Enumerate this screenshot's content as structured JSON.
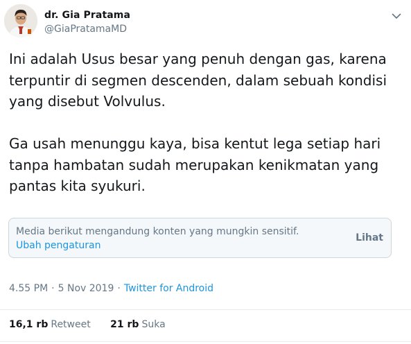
{
  "author": {
    "name": "dr. Gia Pratama",
    "handle": "@GiaPratamaMD"
  },
  "tweet": {
    "paragraph1": "Ini adalah Usus besar yang penuh dengan gas, karena terpuntir di segmen descenden, dalam sebuah kondisi yang disebut Volvulus.",
    "paragraph2": "Ga usah menunggu kaya, bisa kentut lega setiap hari tanpa hambatan sudah merupakan kenikmatan yang pantas kita syukuri."
  },
  "sensitive_media": {
    "message": "Media berikut mengandung konten yang mungkin sensitif.",
    "settings_link": "Ubah pengaturan",
    "view_button": "Lihat"
  },
  "meta": {
    "time": "4.55 PM",
    "date": "5 Nov 2019",
    "separator": "·",
    "source": "Twitter for Android"
  },
  "stats": {
    "retweets_count": "16,1 rb",
    "retweets_label": "Retweet",
    "likes_count": "21 rb",
    "likes_label": "Suka"
  },
  "icons": {
    "caret": "chevron-down-icon"
  },
  "colors": {
    "text": "#14171a",
    "secondary": "#657786",
    "link": "#1b95e0",
    "border": "#ccd6dd",
    "box_bg": "#f5f8fa"
  }
}
